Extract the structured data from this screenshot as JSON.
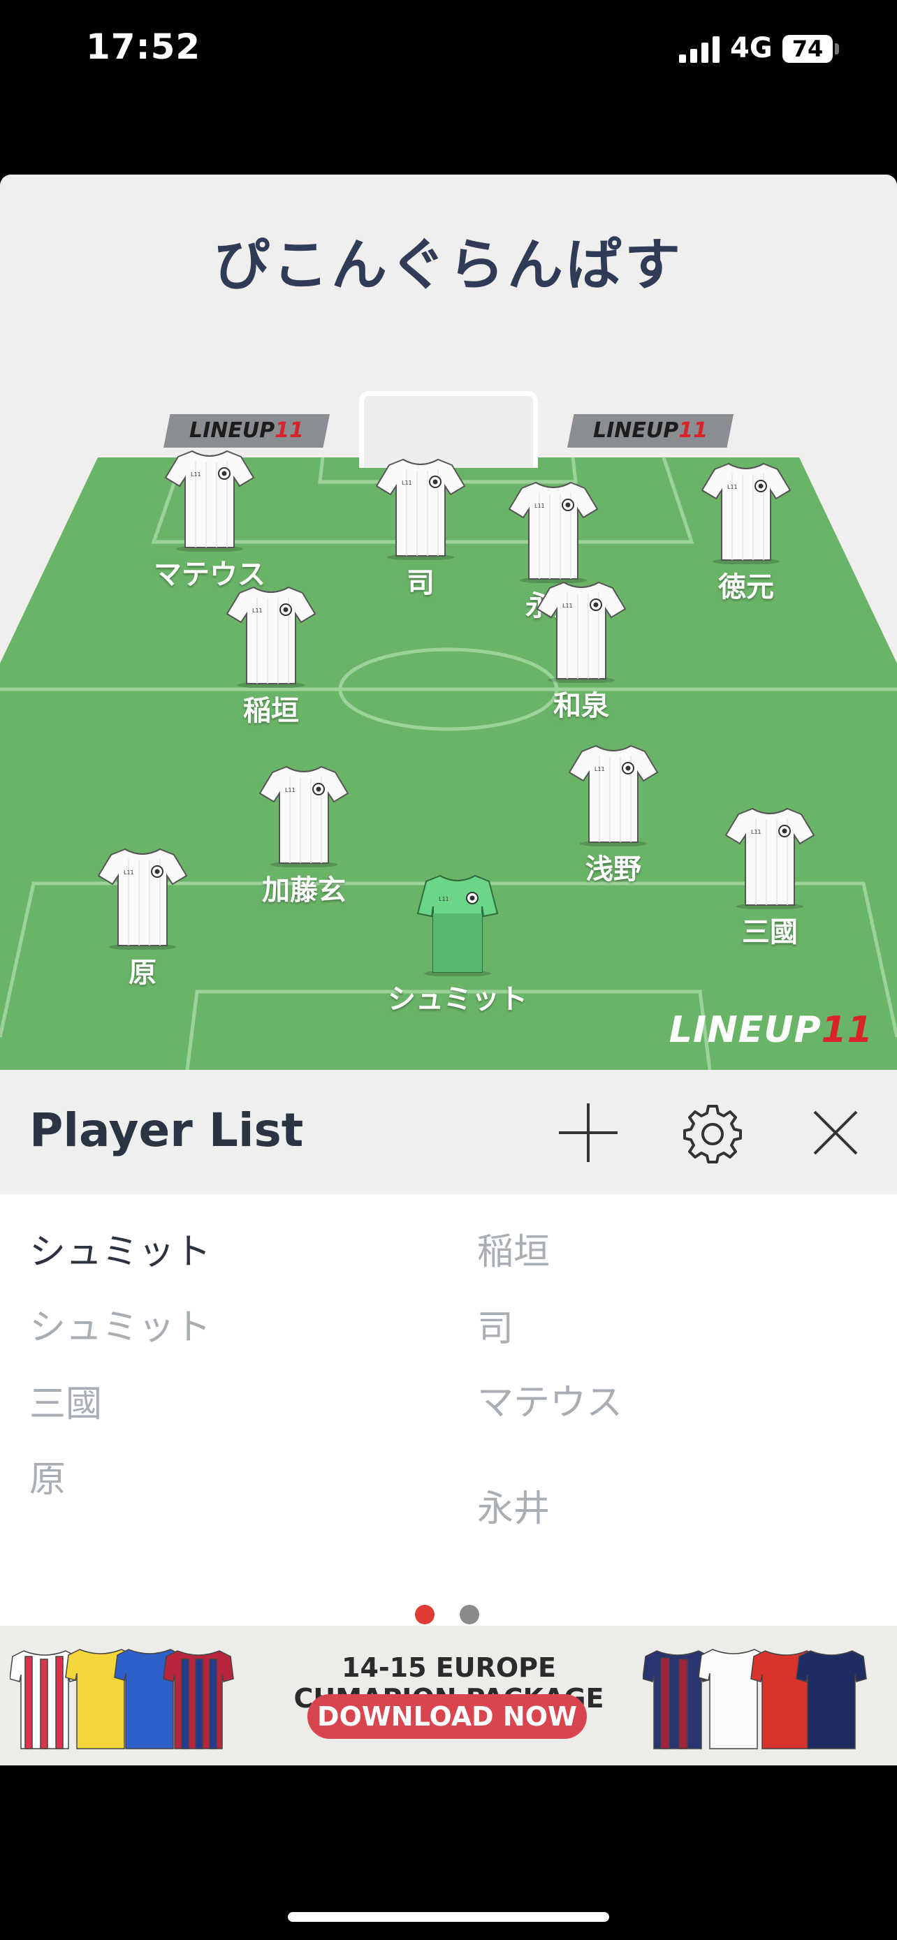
{
  "status_bar": {
    "time": "17:52",
    "network": "4G",
    "battery": "74"
  },
  "team": {
    "name": "ぴこんぐらんぱす"
  },
  "brand": {
    "board_text": "LINEUP",
    "board_eleven": "11",
    "mark_text": "LINEUP",
    "mark_eleven": "11"
  },
  "players": [
    {
      "name": "マテウス"
    },
    {
      "name": "司"
    },
    {
      "name": "永井"
    },
    {
      "name": "徳元"
    },
    {
      "name": "稲垣"
    },
    {
      "name": "和泉"
    },
    {
      "name": "加藤玄"
    },
    {
      "name": "浅野"
    },
    {
      "name": "原"
    },
    {
      "name": "三國"
    },
    {
      "name": "シュミット"
    }
  ],
  "player_list": {
    "title": "Player List",
    "add_icon": "plus-icon",
    "settings_icon": "gear-icon",
    "close_icon": "close-icon",
    "left_column": [
      "シュミット",
      "シュミット",
      "三國",
      "原"
    ],
    "right_column": [
      "稲垣",
      "司",
      "マテウス",
      "永井"
    ],
    "page_count": 2,
    "current_page": 1
  },
  "banner": {
    "headline": "14-15 EUROPE CHMAPION PACKAGE",
    "button_label": "DOWNLOAD NOW"
  },
  "colors": {
    "pitch_green": "#6ab467",
    "title_navy": "#2f3b57",
    "accent_red": "#d8232a",
    "keeper_green": "#6bd687",
    "dot_active": "#e03a34",
    "dot_inactive": "#8a8a8a"
  }
}
